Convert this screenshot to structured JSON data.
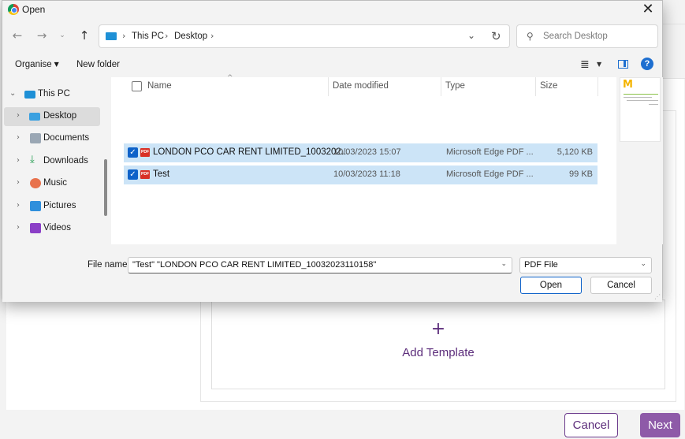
{
  "background": {
    "add_template_icon": "+",
    "add_template_label": "Add Template",
    "cancel_label": "Cancel",
    "next_label": "Next",
    "accent_color": "#5c2d7b"
  },
  "dialog": {
    "title": "Open",
    "close_icon": "close-icon",
    "address": {
      "segments": [
        "This PC",
        "Desktop"
      ]
    },
    "search": {
      "placeholder": "Search Desktop"
    },
    "toolbar": {
      "organise_label": "Organise",
      "new_folder_label": "New folder"
    },
    "tree": {
      "items": [
        {
          "label": "This PC",
          "icon": "computer-icon"
        },
        {
          "label": "Desktop",
          "icon": "desktop-folder-icon"
        },
        {
          "label": "Documents",
          "icon": "documents-icon"
        },
        {
          "label": "Downloads",
          "icon": "downloads-icon"
        },
        {
          "label": "Music",
          "icon": "music-icon"
        },
        {
          "label": "Pictures",
          "icon": "pictures-icon"
        },
        {
          "label": "Videos",
          "icon": "videos-icon"
        }
      ]
    },
    "columns": {
      "name": "Name",
      "date": "Date modified",
      "type": "Type",
      "size": "Size"
    },
    "files": [
      {
        "name": "LONDON PCO CAR RENT LIMITED_1003202...",
        "date": "10/03/2023 15:07",
        "type": "Microsoft Edge PDF ...",
        "size": "5,120 KB",
        "selected": true
      },
      {
        "name": "Test",
        "date": "10/03/2023 11:18",
        "type": "Microsoft Edge PDF ...",
        "size": "99 KB",
        "selected": true
      }
    ],
    "footer": {
      "file_name_label": "File name:",
      "file_name_value": "\"Test\" \"LONDON PCO CAR RENT LIMITED_10032023110158\"",
      "file_type_value": "PDF File",
      "open_label": "Open",
      "cancel_label": "Cancel"
    }
  }
}
